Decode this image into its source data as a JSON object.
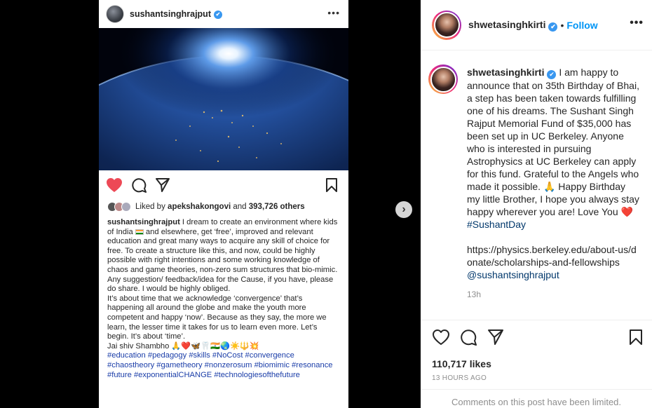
{
  "inner_post": {
    "username": "sushantsinghrajput",
    "verified_mark": "✔",
    "more": "•••",
    "likes_prefix": "Liked by",
    "likes_user": "apekshakongovi",
    "likes_and": "and",
    "likes_count": "393,726 others",
    "caption_user": "sushantsinghrajput",
    "caption_p1a": "I dream to create an environment where kids of India",
    "caption_p1b": "and elsewhere, get ‘free’, improved and relevant education and great many ways to acquire any skill of choice for free. To create a structure like this, and now, could be highly possible with right intentions and some working knowledge of chaos and game theories, non-zero sum structures that bio-mimic. Any suggestion/ feedback/idea for the Cause, if you have, please do share. I would be highly obliged.",
    "caption_p2": "It’s about time that we acknowledge ‘convergence’ that’s happening all around the globe and make the youth more competent and happy ‘now’. Because as they say, the more we learn, the lesser time it takes for us to learn even more. Let’s begin. It’s about ‘time’.",
    "caption_p3": "Jai shiv Shambho 🙏❤️🦋🦷🇮🇳🌏☀️🔱💥",
    "hashtags": "#education #pedagogy #skills #NoCost #convergence #chaostheory #gametheory #nonzerosum #biomimic #resonance #future #exponentialCHANGE #technologiesofthefuture"
  },
  "next_button": "›",
  "panel": {
    "username": "shwetasinghkirti",
    "verified_mark": "✔",
    "dot": "•",
    "follow_label": "Follow",
    "more": "•••",
    "caption_user": "shwetasinghkirti",
    "caption_text": "I am happy to announce that on 35th Birthday of Bhai, a step has been taken towards fulfilling one of his dreams. The Sushant Singh Rajput Memorial Fund of $35,000 has been set up in UC Berkeley. Anyone who is interested in pursuing Astrophysics at UC Berkeley can apply for this fund. Grateful to the Angels who made it possible. 🙏 Happy Birthday my little Brother, I hope you always stay happy wherever you are! Love You ❤️",
    "caption_hashtag": "#SushantDay",
    "caption_url": "https://physics.berkeley.edu/about-us/donate/scholarships-and-fellowships",
    "caption_mention": "@sushantsinghrajput",
    "time_ago": "13h",
    "likes": "110,717 likes",
    "date": "13 HOURS AGO",
    "comments_limited": "Comments on this post have been limited."
  },
  "colors": {
    "accent": "#0095f6",
    "like_red": "#ed4956",
    "link": "#00376b",
    "muted": "#8e8e8e"
  }
}
